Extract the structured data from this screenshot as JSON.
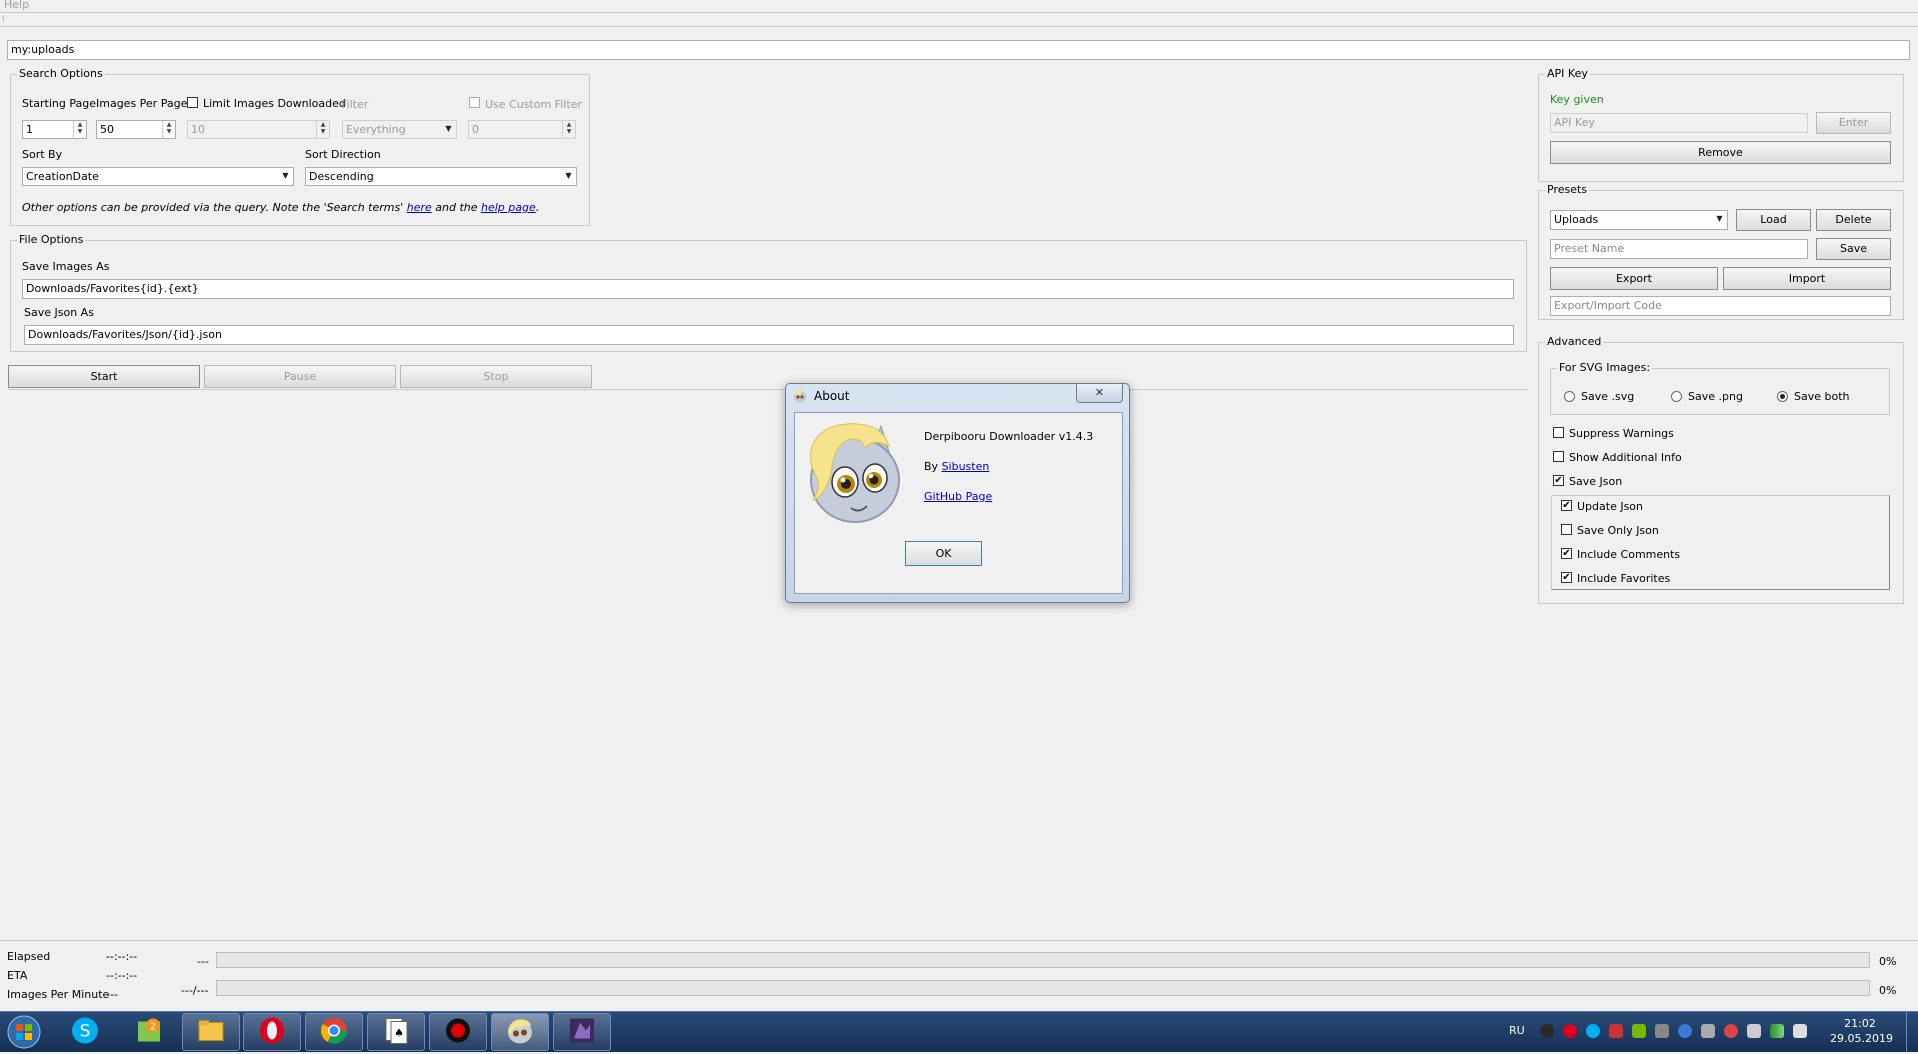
{
  "menu": {
    "help": "Help"
  },
  "query": "my:uploads",
  "search_options": {
    "title": "Search Options",
    "starting_page_label": "Starting Page",
    "starting_page": "1",
    "images_per_page_label": "Images Per Page",
    "images_per_page": "50",
    "limit_label": "Limit Images Downloaded",
    "limit_value": "10",
    "filter_label": "Filter",
    "filter_value": "Everything",
    "custom_filter_label": "Use Custom Filter",
    "custom_filter_value": "0",
    "sort_by_label": "Sort By",
    "sort_by": "CreationDate",
    "sort_direction_label": "Sort Direction",
    "sort_direction": "Descending",
    "note_prefix": "Other options can be provided via the query. Note the 'Search terms' ",
    "note_link1": "here",
    "note_mid": " and the ",
    "note_link2": "help page",
    "note_suffix": "."
  },
  "file_options": {
    "title": "File Options",
    "save_images_label": "Save Images As",
    "save_images_value": "Downloads/Favorites{id}.{ext}",
    "save_json_label": "Save Json As",
    "save_json_value": "Downloads/Favorites/Json/{id}.json"
  },
  "controls": {
    "start": "Start",
    "pause": "Pause",
    "stop": "Stop"
  },
  "api_key": {
    "title": "API Key",
    "status": "Key given",
    "placeholder": "API Key",
    "enter": "Enter",
    "remove": "Remove"
  },
  "presets": {
    "title": "Presets",
    "selected": "Uploads",
    "load": "Load",
    "delete": "Delete",
    "name_placeholder": "Preset Name",
    "save": "Save",
    "export": "Export",
    "import": "Import",
    "code_placeholder": "Export/Import Code"
  },
  "advanced": {
    "title": "Advanced",
    "svg_group": "For SVG Images:",
    "svg_options": [
      "Save .svg",
      "Save .png",
      "Save both"
    ],
    "svg_selected": 2,
    "suppress_warnings": "Suppress Warnings",
    "show_additional_info": "Show Additional Info",
    "save_json": "Save Json",
    "update_json": "Update Json",
    "save_only_json": "Save Only Json",
    "include_comments": "Include Comments",
    "include_favorites": "Include Favorites",
    "checked": {
      "suppress_warnings": false,
      "show_additional_info": false,
      "save_json": true,
      "update_json": true,
      "save_only_json": false,
      "include_comments": true,
      "include_favorites": true
    }
  },
  "status": {
    "elapsed_label": "Elapsed",
    "elapsed_value": "--:--:--",
    "eta_label": "ETA",
    "eta_value": "--:--:--",
    "ipm_label": "Images Per Minute",
    "ipm_value": "---",
    "progress1_text": "---",
    "progress1_pct": "0%",
    "progress1_fraction": 0,
    "progress2_text": "---/---",
    "progress2_pct": "0%",
    "progress2_fraction": 0
  },
  "about": {
    "title": "About",
    "app_name": "Derpibooru Downloader v1.4.3",
    "by_prefix": "By ",
    "author": "Sibusten",
    "github": "GitHub Page",
    "ok": "OK"
  },
  "taskbar": {
    "lang": "RU",
    "time": "21:02",
    "date": "29.05.2019",
    "apps": [
      "windows-start",
      "skype",
      "maps",
      "file-explorer",
      "opera",
      "chrome",
      "solitaire",
      "recorder",
      "derpibooru-downloader",
      "pony-app"
    ]
  },
  "colors": {
    "window_bg": "#f0f0f0",
    "key_given": "#1e8c1e",
    "link": "#0000cc",
    "taskbar": "#1f3c66"
  }
}
